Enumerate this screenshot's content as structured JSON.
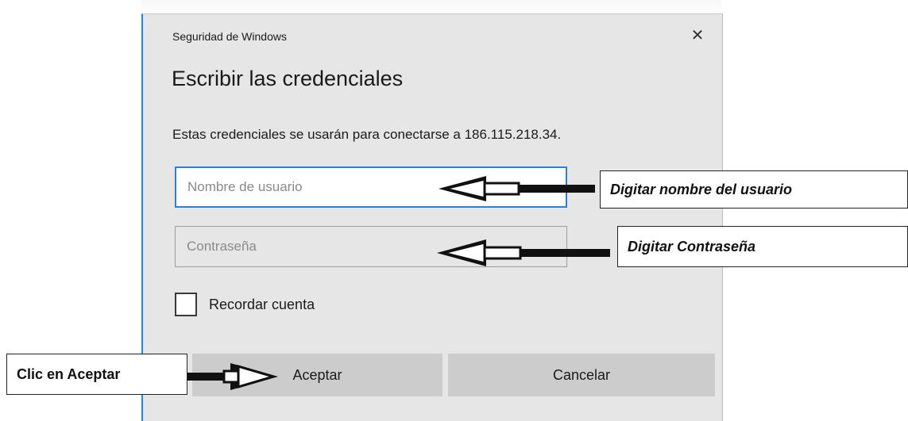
{
  "dialog": {
    "caption": "Seguridad de Windows",
    "close_glyph": "✕",
    "heading": "Escribir las credenciales",
    "description": "Estas credenciales se usarán para conectarse a 186.115.218.34.",
    "username_placeholder": "Nombre de usuario",
    "password_placeholder": "Contraseña",
    "remember_label": "Recordar cuenta",
    "accept_label": "Aceptar",
    "cancel_label": "Cancelar"
  },
  "annotations": {
    "user_callout": "Digitar nombre del usuario",
    "password_callout": "Digitar Contraseña",
    "accept_callout": "Clic en Aceptar"
  },
  "colors": {
    "dialog_bg": "#e6e6e6",
    "focus_border": "#2c7fd6",
    "button_bg": "#cccccc"
  }
}
